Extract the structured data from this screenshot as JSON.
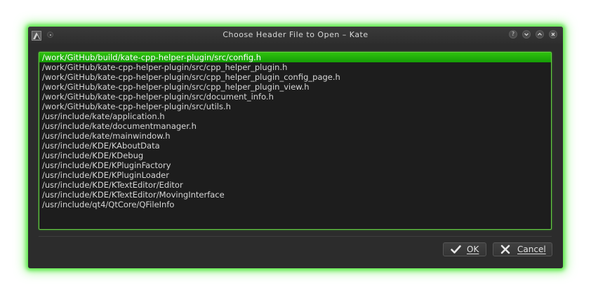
{
  "window": {
    "title": "Choose Header File to Open – Kate",
    "title_buttons": [
      "help",
      "minimize",
      "maximize",
      "close"
    ],
    "help_glyph": "?"
  },
  "file_list": {
    "selected_index": 0,
    "items": [
      "/work/GitHub/build/kate-cpp-helper-plugin/src/config.h",
      "/work/GitHub/kate-cpp-helper-plugin/src/cpp_helper_plugin.h",
      "/work/GitHub/kate-cpp-helper-plugin/src/cpp_helper_plugin_config_page.h",
      "/work/GitHub/kate-cpp-helper-plugin/src/cpp_helper_plugin_view.h",
      "/work/GitHub/kate-cpp-helper-plugin/src/document_info.h",
      "/work/GitHub/kate-cpp-helper-plugin/src/utils.h",
      "/usr/include/kate/application.h",
      "/usr/include/kate/documentmanager.h",
      "/usr/include/kate/mainwindow.h",
      "/usr/include/KDE/KAboutData",
      "/usr/include/KDE/KDebug",
      "/usr/include/KDE/KPluginFactory",
      "/usr/include/KDE/KPluginLoader",
      "/usr/include/KDE/KTextEditor/Editor",
      "/usr/include/KDE/KTextEditor/MovingInterface",
      "/usr/include/qt4/QtCore/QFileInfo"
    ]
  },
  "buttons": {
    "ok_label": "OK",
    "ok_icon": "checkmark-icon",
    "cancel_label": "Cancel",
    "cancel_icon": "x-icon"
  },
  "colors": {
    "selection": "#1fae0a",
    "window_glow": "#5de84a",
    "list_border": "#66cc44"
  }
}
